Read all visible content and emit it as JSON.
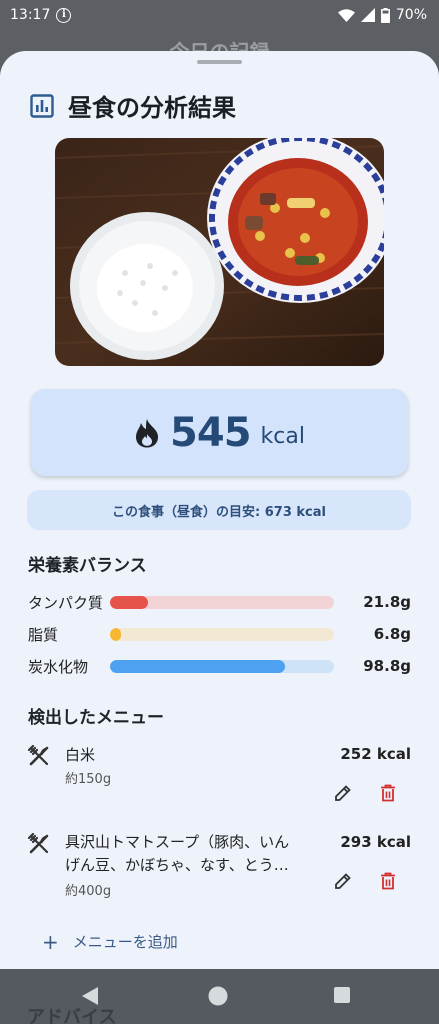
{
  "status_bar": {
    "time": "13:17",
    "info_glyph": "i",
    "battery": "70%"
  },
  "background_title": "今日の記録",
  "sheet": {
    "title": "昼食の分析結果",
    "calories": {
      "value": "545",
      "unit": "kcal"
    },
    "guide_text": "この食事（昼食）の目安: 673 kcal",
    "nutrition": {
      "heading": "栄養素バランス",
      "items": [
        {
          "label": "タンパク質",
          "value": "21.8g",
          "fill": 0.17,
          "bar_color": "#e5534b",
          "track_color": "#f1d3d6"
        },
        {
          "label": "脂質",
          "value": "6.8g",
          "fill": 0.05,
          "bar_color": "#f7b731",
          "track_color": "#f2e8d4"
        },
        {
          "label": "炭水化物",
          "value": "98.8g",
          "fill": 0.78,
          "bar_color": "#4ea1f0",
          "track_color": "#cfe3f8"
        }
      ]
    },
    "menu": {
      "heading": "検出したメニュー",
      "items": [
        {
          "name": "白米",
          "quantity": "約150g",
          "kcal": "252 kcal"
        },
        {
          "name_line1": "具沢山トマトスープ（豚肉、いん",
          "name_line2": "げん豆、かぼちゃ、なす、とう…",
          "quantity": "約400g",
          "kcal": "293 kcal"
        }
      ],
      "add_label": "メニューを追加"
    }
  },
  "advice_heading": "アドバイス",
  "icons": [
    "info-icon",
    "wifi-icon",
    "signal-icon",
    "battery-icon",
    "chart-icon",
    "flame-icon",
    "fork-knife-icon",
    "edit-icon",
    "delete-icon",
    "plus-icon",
    "back-icon",
    "home-icon",
    "recents-icon"
  ]
}
